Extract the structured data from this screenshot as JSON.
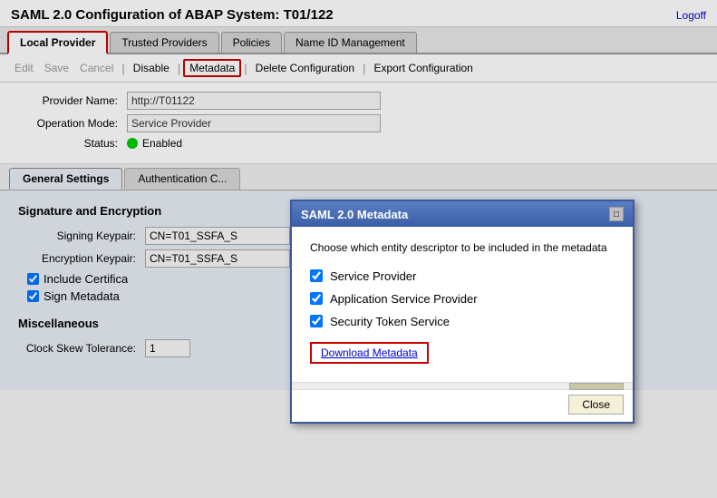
{
  "header": {
    "title": "SAML 2.0 Configuration of ABAP System: T01/122",
    "logoff": "Logoff"
  },
  "tabs": [
    {
      "label": "Local Provider",
      "active": true
    },
    {
      "label": "Trusted Providers",
      "active": false
    },
    {
      "label": "Policies",
      "active": false
    },
    {
      "label": "Name ID Management",
      "active": false
    }
  ],
  "toolbar": {
    "edit": "Edit",
    "save": "Save",
    "cancel": "Cancel",
    "separator1": "|",
    "disable": "Disable",
    "separator2": "|",
    "metadata": "Metadata",
    "separator3": "|",
    "delete": "Delete Configuration",
    "separator4": "|",
    "export": "Export Configuration"
  },
  "form": {
    "provider_name_label": "Provider Name:",
    "provider_name_value": "http://T01122",
    "operation_mode_label": "Operation Mode:",
    "operation_mode_value": "Service Provider",
    "status_label": "Status:",
    "status_text": "Enabled"
  },
  "content_tabs": [
    {
      "label": "General Settings",
      "active": true
    },
    {
      "label": "Authentication C...",
      "active": false
    }
  ],
  "general_settings": {
    "signature_section": "Signature and Encryption",
    "signing_keypair_label": "Signing Keypair:",
    "signing_keypair_value": "CN=T01_SSFA_S",
    "encryption_keypair_label": "Encryption Keypair:",
    "encryption_keypair_value": "CN=T01_SSFA_S",
    "include_cert_label": "Include Certifica",
    "sign_metadata_label": "Sign Metadata",
    "misc_section": "Miscellaneous",
    "clock_skew_label": "Clock Skew Tolerance:",
    "clock_skew_value": "1"
  },
  "modal": {
    "title": "SAML 2.0 Metadata",
    "description": "Choose which entity descriptor to be included in the metadata",
    "checkboxes": [
      {
        "label": "Service Provider",
        "checked": true
      },
      {
        "label": "Application Service Provider",
        "checked": true
      },
      {
        "label": "Security Token Service",
        "checked": true
      }
    ],
    "download_btn": "Download Metadata",
    "close_btn": "Close"
  }
}
